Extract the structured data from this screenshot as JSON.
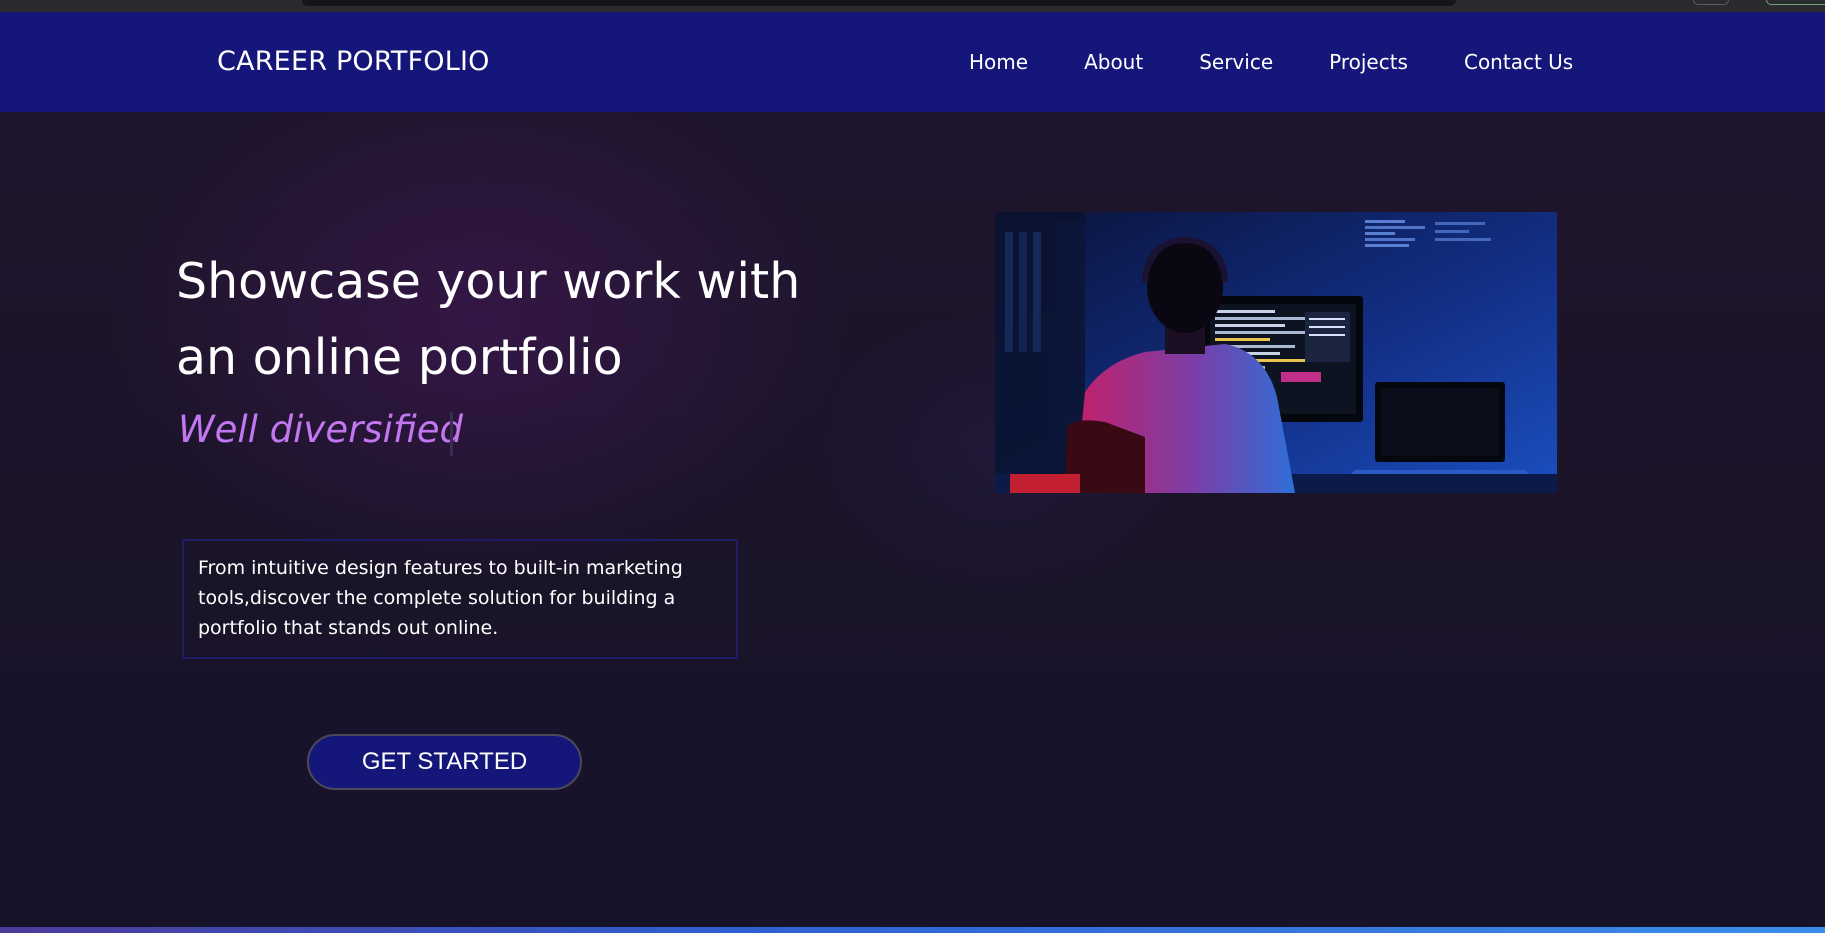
{
  "brand": "CAREER PORTFOLIO",
  "nav": {
    "items": [
      {
        "label": "Home"
      },
      {
        "label": "About"
      },
      {
        "label": "Service"
      },
      {
        "label": "Projects"
      },
      {
        "label": "Contact Us"
      }
    ]
  },
  "hero": {
    "headline": "Showcase your work with an online portfolio",
    "tagline": "Well diversified",
    "description": "From intuitive design features to built-in marketing tools,discover the complete solution for building a portfolio that stands out online.",
    "cta_label": "GET STARTED"
  },
  "colors": {
    "navbar": "#15167a",
    "background": "#1c1428",
    "tagline": "#c277f0",
    "cta": "#15167a"
  }
}
